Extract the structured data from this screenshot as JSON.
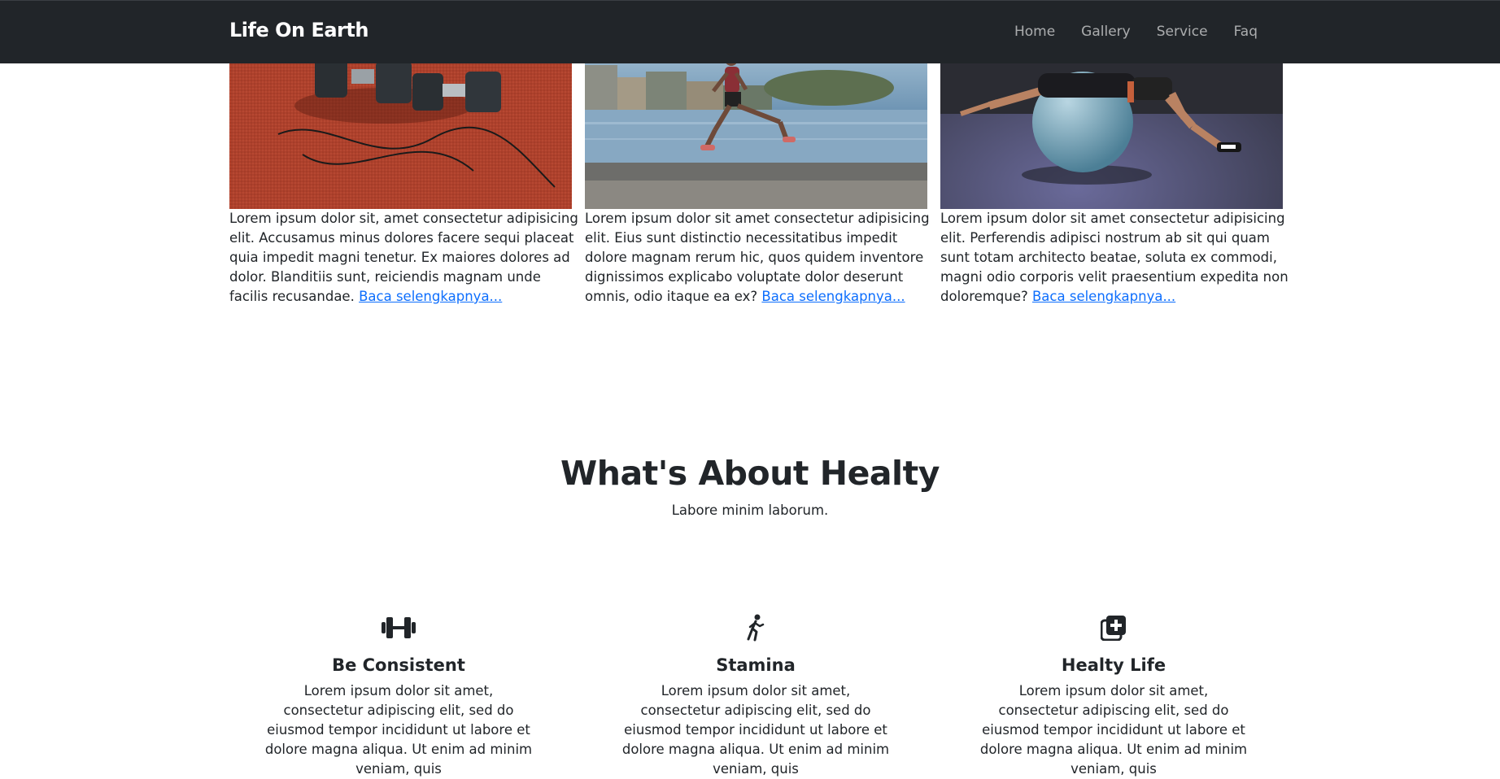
{
  "navbar": {
    "brand": "Life On Earth",
    "links": [
      "Home",
      "Gallery",
      "Service",
      "Faq"
    ]
  },
  "cards": [
    {
      "image_desc": "dumbbells-on-track",
      "text": "Lorem ipsum dolor sit, amet consectetur adipisicing elit. Accusamus minus dolores facere sequi placeat quia impedit magni tenetur. Ex maiores dolores ad dolor. Blanditiis sunt, reiciendis magnam unde facilis recusandae.",
      "link": "Baca selengkapnya..."
    },
    {
      "image_desc": "runner-by-sea",
      "text": "Lorem ipsum dolor sit amet consectetur adipisicing elit. Eius sunt distinctio necessitatibus impedit dolore magnam rerum hic, quos quidem inventore dignissimos explicabo voluptate dolor deserunt omnis, odio itaque ea ex?",
      "link": "Baca selengkapnya..."
    },
    {
      "image_desc": "woman-on-exercise-ball",
      "text": "Lorem ipsum dolor sit amet consectetur adipisicing elit. Perferendis adipisci nostrum ab sit qui quam sunt totam architecto beatae, soluta ex commodi, magni odio corporis velit praesentium expedita non doloremque?",
      "link": "Baca selengkapnya..."
    }
  ],
  "about": {
    "title": "What's About Healty",
    "subtitle": "Labore minim laborum."
  },
  "features": [
    {
      "icon": "dumbbell-icon",
      "title": "Be Consistent",
      "text": "Lorem ipsum dolor sit amet, consectetur adipiscing elit, sed do eiusmod tempor incididunt ut labore et dolore magna aliqua. Ut enim ad minim veniam, quis"
    },
    {
      "icon": "running-person-icon",
      "title": "Stamina",
      "text": "Lorem ipsum dolor sit amet, consectetur adipiscing elit, sed do eiusmod tempor incididunt ut labore et dolore magna aliqua. Ut enim ad minim veniam, quis"
    },
    {
      "icon": "medical-plus-icon",
      "title": "Healty Life",
      "text": "Lorem ipsum dolor sit amet, consectetur adipiscing elit, sed do eiusmod tempor incididunt ut labore et dolore magna aliqua. Ut enim ad minim veniam, quis"
    }
  ],
  "colors": {
    "navbar_bg": "#212529",
    "link": "#0d6efd",
    "text": "#212529"
  }
}
